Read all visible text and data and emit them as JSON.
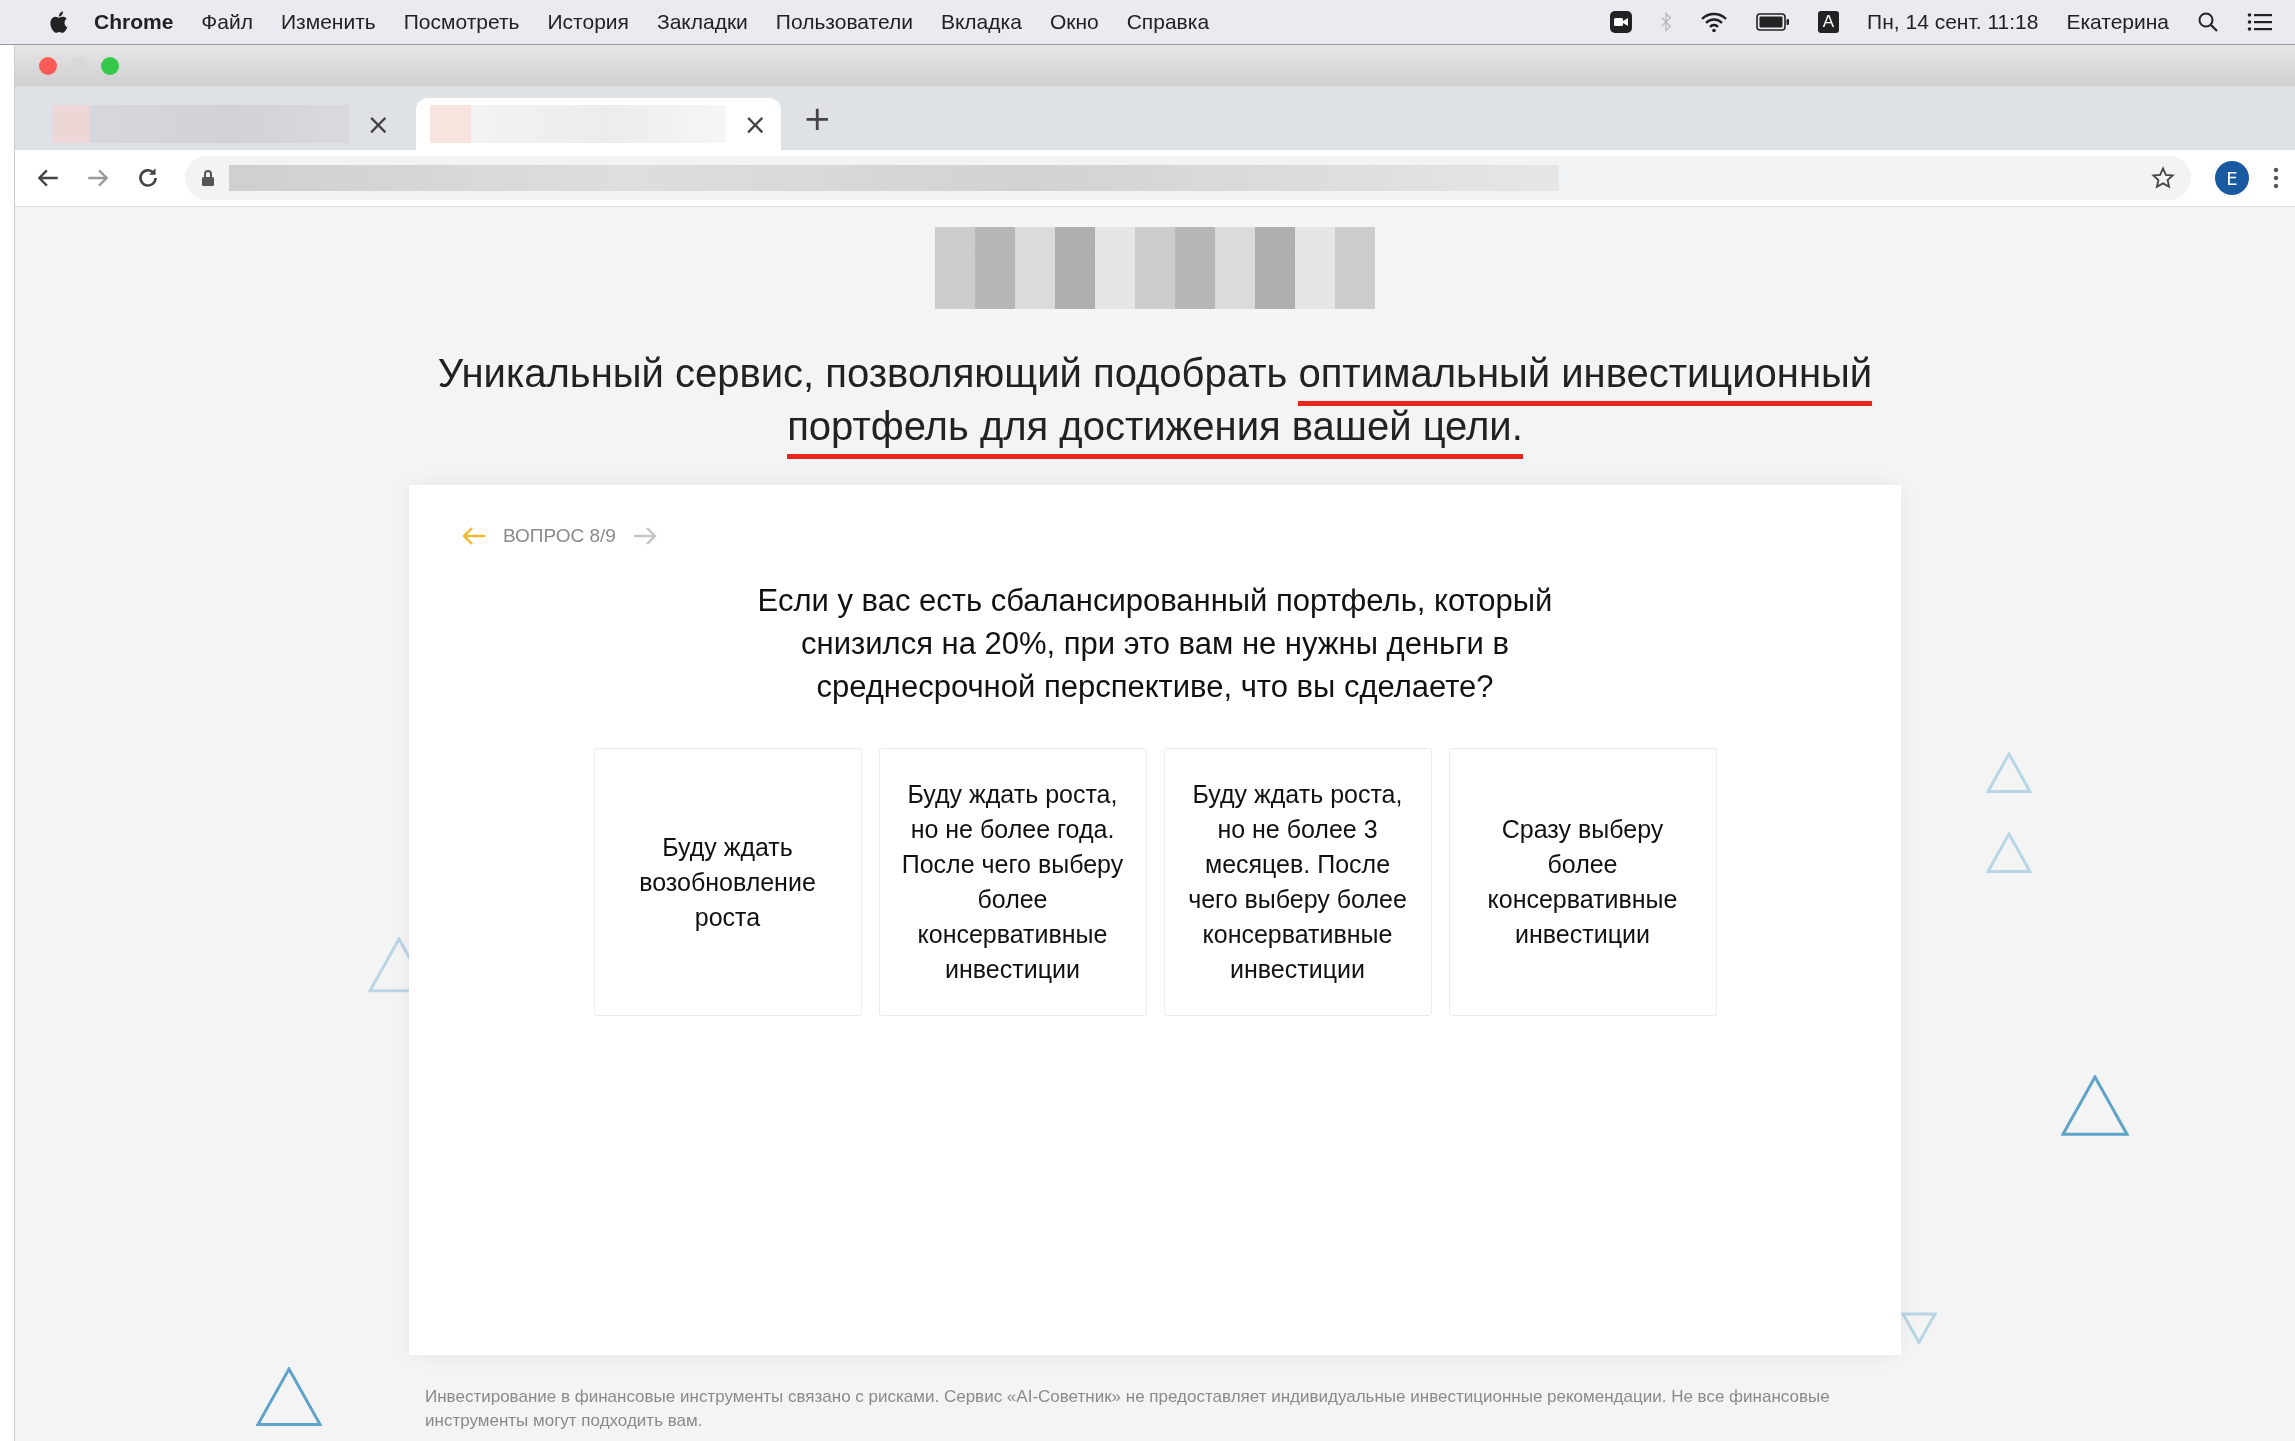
{
  "menu_bar": {
    "app": "Chrome",
    "items": [
      "Файл",
      "Изменить",
      "Посмотреть",
      "История",
      "Закладки",
      "Пользователи",
      "Вкладка",
      "Окно",
      "Справка"
    ],
    "input_source": "A",
    "datetime": "Пн, 14 сент.  11:18",
    "user": "Екатерина"
  },
  "tabs": [
    {
      "close": "×",
      "selected": false
    },
    {
      "close": "×",
      "selected": true
    }
  ],
  "new_tab": "+",
  "toolbar": {
    "profile_initial": "E"
  },
  "heading": [
    {
      "text": "Уникальный сервис, позволяющий подобрать ",
      "underlined": false
    },
    {
      "text": "оптимальный инвестиционный портфель для достижения вашей цели.",
      "underlined": true
    }
  ],
  "quiz": {
    "prev_enabled": true,
    "next_enabled": false,
    "progress": "ВОПРОС 8/9",
    "question": "Если у вас есть сбалансированный портфель, который снизился на 20%, при это вам не нужны деньги в среднесрочной перспективе, что вы сделаете?",
    "answers": [
      "Буду ждать возобновление роста",
      "Буду ждать роста, но не более года. После чего выберу более консервативные инвестиции",
      "Буду ждать роста, но не более 3 месяцев. После чего выберу более консервативные инвестиции",
      "Сразу выберу более консервативные инвестиции"
    ]
  },
  "disclaimer": "Инвестирование в финансовые инструменты связано с рисками. Сервис «AI-Советник» не предоставляет индивидуальные инвестиционные рекомендации. Не все финансовые инструменты могут подходить вам."
}
